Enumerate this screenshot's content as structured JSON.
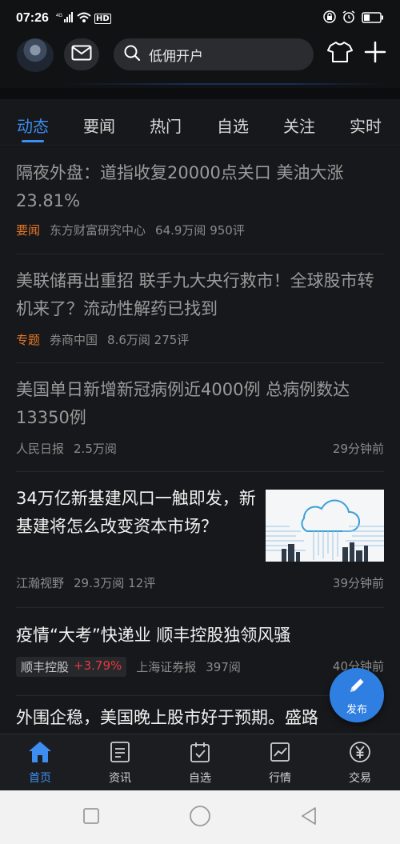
{
  "status_bar": {
    "time": "07:26",
    "network": "4G",
    "hd": "HD"
  },
  "header": {
    "search_placeholder": "低佣开户"
  },
  "tabs": [
    {
      "label": "动态",
      "active": true
    },
    {
      "label": "要闻"
    },
    {
      "label": "热门"
    },
    {
      "label": "自选"
    },
    {
      "label": "关注"
    },
    {
      "label": "实时"
    }
  ],
  "feed": [
    {
      "title": "隔夜外盘：道指收复20000点关口 美油大涨23.81%",
      "tag": "要闻",
      "source": "东方财富研究中心",
      "stats": "64.9万阅 950评"
    },
    {
      "title": "美联储再出重招 联手九大央行救市！全球股市转机来了？流动性解药已找到",
      "tag": "专题",
      "source": "券商中国",
      "stats": "8.6万阅 275评"
    },
    {
      "title": "美国单日新增新冠病例近4000例 总病例数达13350例",
      "source": "人民日报",
      "stats": "2.5万阅",
      "time": "29分钟前"
    },
    {
      "title": "34万亿新基建风口一触即发，新基建将怎么改变资本市场？",
      "source": "江瀚视野",
      "stats": "29.3万阅 12评",
      "time": "39分钟前"
    },
    {
      "title": "疫情“大考”快递业 顺丰控股独领风骚",
      "stock_name": "顺丰控股",
      "stock_change": "+3.79%",
      "source": "上海证券报",
      "stats": "397阅",
      "time": "40分钟前"
    },
    {
      "title": "外围企稳，美国晚上股市好于预期。盛路"
    }
  ],
  "fab": {
    "label": "发布"
  },
  "bottom_nav": [
    {
      "label": "首页",
      "icon": "home-icon",
      "active": true
    },
    {
      "label": "资讯",
      "icon": "news-icon"
    },
    {
      "label": "自选",
      "icon": "watchlist-icon"
    },
    {
      "label": "行情",
      "icon": "market-icon"
    },
    {
      "label": "交易",
      "icon": "trade-icon"
    }
  ],
  "colors": {
    "accent": "#3d8ef0",
    "tag_orange": "#e5762a",
    "stock_up": "#e8383d",
    "background": "#17181b"
  }
}
